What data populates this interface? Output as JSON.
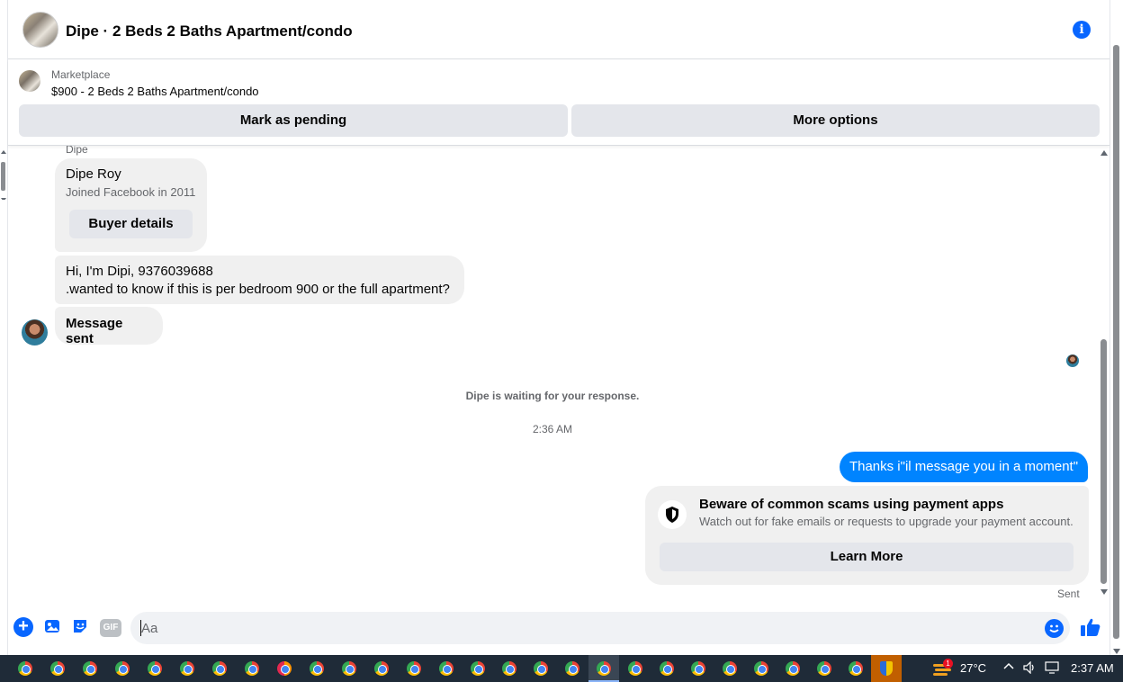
{
  "header": {
    "title": "Dipe · 2 Beds 2 Baths Apartment/condo"
  },
  "marketplace": {
    "label": "Marketplace",
    "item": "$900 - 2 Beds 2 Baths Apartment/condo",
    "mark_pending": "Mark as pending",
    "more_options": "More options"
  },
  "conversation": {
    "sender_small": "Dipe",
    "buyer_card": {
      "name": "Dipe Roy",
      "joined": "Joined Facebook in 2011",
      "details_button": "Buyer details"
    },
    "messages": [
      {
        "line1": "Hi, I'm Dipi, 9376039688",
        "line2": ".wanted to know if this is per bedroom 900 or the full apartment?"
      },
      {
        "text": "Message sent"
      }
    ],
    "waiting": "Dipe is waiting for your response.",
    "timestamp": "2:36 AM",
    "outgoing": "Thanks i\"il message you in a moment\"",
    "scam_notice": {
      "title": "Beware of common scams using payment apps",
      "subtitle": "Watch out for fake emails or requests to upgrade your payment account.",
      "button": "Learn More"
    },
    "status": "Sent"
  },
  "composer": {
    "placeholder": "Aa",
    "gif_label": "GIF"
  },
  "taskbar": {
    "temperature": "27°C",
    "clock": "2:37 AM",
    "notification_count": "1"
  },
  "colors": {
    "accent": "#0866ff",
    "outgoing_bubble": "#0084ff",
    "incoming_bubble": "#f0f0f0",
    "button_bg": "#e4e6eb",
    "taskbar_bg": "#1f2b38"
  }
}
